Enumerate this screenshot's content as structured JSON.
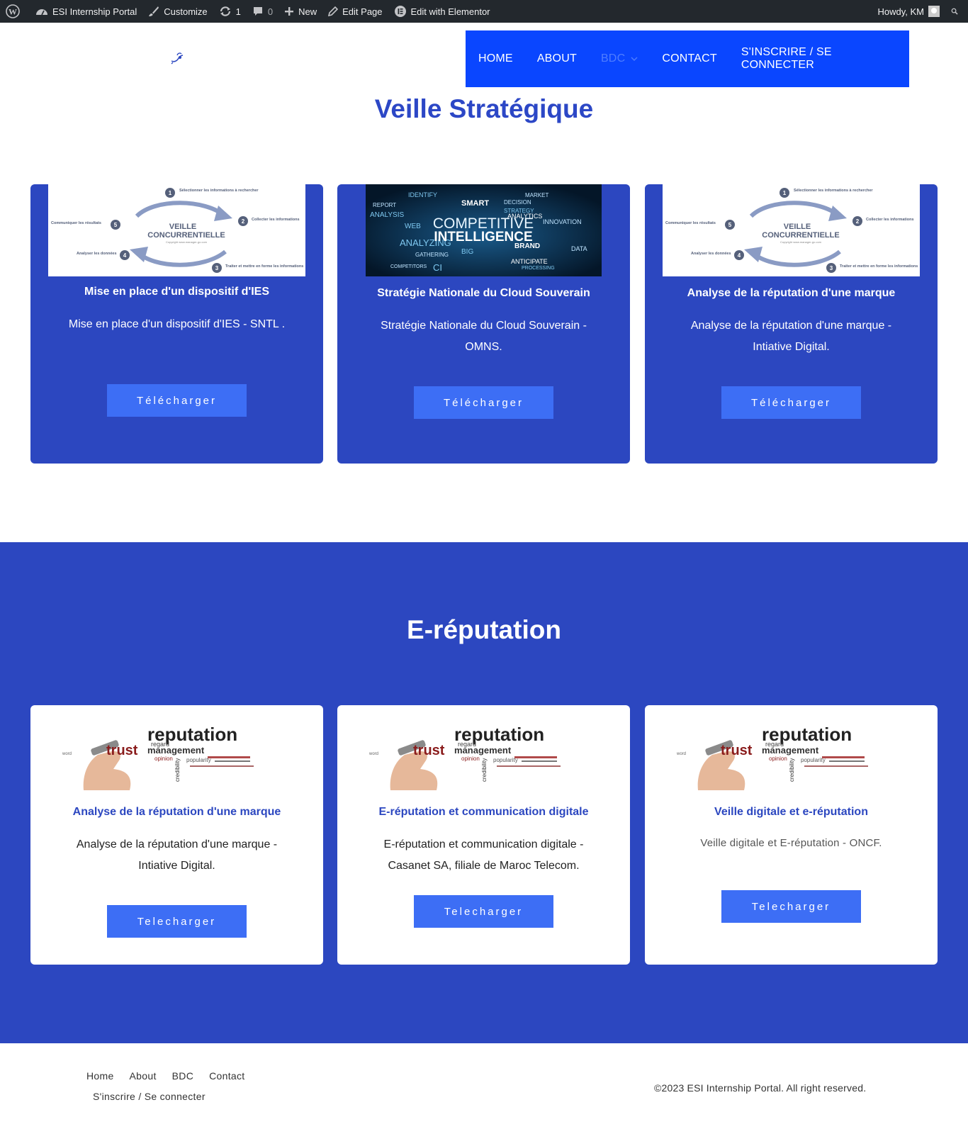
{
  "adminbar": {
    "site_name": "ESI Internship Portal",
    "customize": "Customize",
    "updates_count": "1",
    "comments_count": "0",
    "new": "New",
    "edit_page": "Edit Page",
    "edit_elementor": "Edit with Elementor",
    "howdy": "Howdy, KM"
  },
  "nav": {
    "items": [
      "HOME",
      "ABOUT",
      "BDC",
      "CONTACT",
      "S'INSCRIRE / SE CONNECTER"
    ]
  },
  "section1": {
    "title": "Veille Stratégique",
    "cards": [
      {
        "title": "Mise en place d'un dispositif d'IES",
        "desc": "Mise en place d'un dispositif d'IES - SNTL .",
        "button": "Télécharger"
      },
      {
        "title": "Stratégie Nationale du Cloud Souverain",
        "desc": "Stratégie Nationale du Cloud Souverain - OMNS.",
        "button": "Télécharger"
      },
      {
        "title": "Analyse de la réputation d'une marque",
        "desc": "Analyse de la réputation d'une marque - Intiative Digital.",
        "button": "Télécharger"
      }
    ],
    "image_text": {
      "veille_title_1": "VEILLE",
      "veille_title_2": "CONCURRENTIELLE",
      "veille_copyright": "Copyright www.manager-go.com",
      "step1": "Sélectionner les informations à rechercher",
      "step2": "Collecter les informations",
      "step3": "Traiter et mettre en forme les informations",
      "step4": "Analyser les données",
      "step5": "Communiquer les résultats",
      "ci_line1": "COMPETITIVE",
      "ci_line2": "INTELLIGENCE",
      "ci_words": [
        "IDENTIFY",
        "MARKET",
        "ANALYSIS",
        "SMART",
        "DECISION",
        "STRATEGY",
        "ANALYTICS",
        "INNOVATION",
        "WEB",
        "ANALYZING",
        "BRAND",
        "DATA",
        "BIG",
        "GATHERING",
        "ANTICIPATE",
        "COMPETITORS",
        "CI",
        "REPORT",
        "PROCESSING"
      ]
    }
  },
  "section2": {
    "title": "E-réputation",
    "cards": [
      {
        "title": "Analyse de la réputation d'une marque",
        "desc": "Analyse de la réputation d'une marque - Intiative Digital.",
        "button": "Telecharger"
      },
      {
        "title": "E-réputation et communication digitale",
        "desc": "E-réputation et communication digitale - Casanet SA, filiale de Maroc Telecom.",
        "button": "Telecharger"
      },
      {
        "title": "Veille digitale et e-réputation",
        "desc": "Veille digitale et E-réputation - ONCF.",
        "button": "Telecharger"
      }
    ],
    "image_text": {
      "word_big": "reputation",
      "word_trust": "trust",
      "word_mgmt": "management",
      "word_regard": "regard",
      "word_opinion": "opinion",
      "word_pop": "popularity",
      "word_cred": "credibility",
      "word_word": "word"
    }
  },
  "footer": {
    "links": [
      "Home",
      "About",
      "BDC",
      "Contact"
    ],
    "link2": "S'inscrire / Se connecter",
    "copyright": "©2023 ESI Internship Portal. All right reserved."
  },
  "colors": {
    "primary_blue": "#2c47c0",
    "nav_blue": "#0a46ff",
    "button_blue": "#3d6ef5",
    "admin_bar": "#23282d"
  }
}
